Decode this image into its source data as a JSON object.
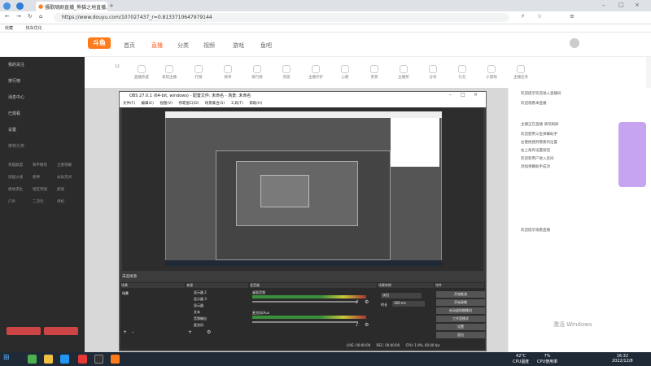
{
  "browser": {
    "tab_title": "骚歌随剧直播_熊猫之地直播...",
    "url": "https://www.douyu.com/107027437_r=0.8133710647979144",
    "bookmarks": [
      "收藏",
      "快车优化"
    ]
  },
  "header": {
    "logo": "斗鱼",
    "nav": [
      "首页",
      "直播",
      "分类",
      "视频",
      "游戏",
      "鱼吧"
    ]
  },
  "icon_row": [
    "12",
    "直播热度",
    "发现主播",
    "打榜",
    "榜单",
    "排行榜",
    "充值",
    "主播守护",
    "心愿",
    "贵宾",
    "主播奖",
    "分享",
    "礼包",
    "小游戏",
    "主播任务"
  ],
  "sidebar": {
    "items": [
      "我的关注",
      "排行榜",
      "消息中心",
      "已观看",
      "设置"
    ],
    "section1": "推荐分类",
    "grid": [
      "英雄联盟",
      "和平精英",
      "王者荣耀",
      "穿越火线",
      "原神",
      "永劫无间",
      "绝地求生",
      "暗区突围",
      "颜值",
      "户外",
      "二次元",
      "单机"
    ]
  },
  "obs": {
    "title": "OBS 27.0.1 (64-bit, windows) - 配置文件: 未命名 - 场景: 未命名",
    "menu": [
      "文件(F)",
      "编辑(E)",
      "视图(V)",
      "停靠窗口(D)",
      "场景集合(S)",
      "工具(T)",
      "帮助(H)"
    ],
    "source_hint": "未选择源",
    "dock_headers": [
      "场景",
      "来源",
      "混音器",
      "场景转换",
      "控件"
    ],
    "scenes": [
      "场景"
    ],
    "sources": [
      "显示器 2",
      "显示器 3",
      "显示器",
      "文本",
      "音频输出",
      "麦克风"
    ],
    "mixer": [
      "桌面音频",
      "麦克风/Aux"
    ],
    "transition": [
      "淡出",
      "时长",
      "300 ms"
    ],
    "controls": [
      "开始推流",
      "开始录制",
      "启动虚拟摄像机",
      "工作室模式",
      "设置",
      "退出"
    ],
    "status": [
      "LIVE: 00:00:00",
      "REC: 00:00:00",
      "CPU: 1.9%, 60.00 fps"
    ]
  },
  "chat": {
    "lines": [
      "欢迎提示欢迎进入直播间",
      "欢迎观看本直播",
      "主播正在直播 请勿刷屏",
      "欢迎使用斗鱼弹幕助手",
      "左键拖拽到需要的位置",
      "右上角有设置按钮",
      "欢迎新用户进入房间",
      "添加弹幕助手成功",
      "欢迎提示观看直播"
    ]
  },
  "taskbar": {
    "temp": "42°C",
    "temp_label": "CPU温度",
    "cpu": "7%",
    "cpu_label": "CPU使用率",
    "time": "16:32",
    "date": "2022/12/8",
    "watermark": "激活 Windows"
  }
}
